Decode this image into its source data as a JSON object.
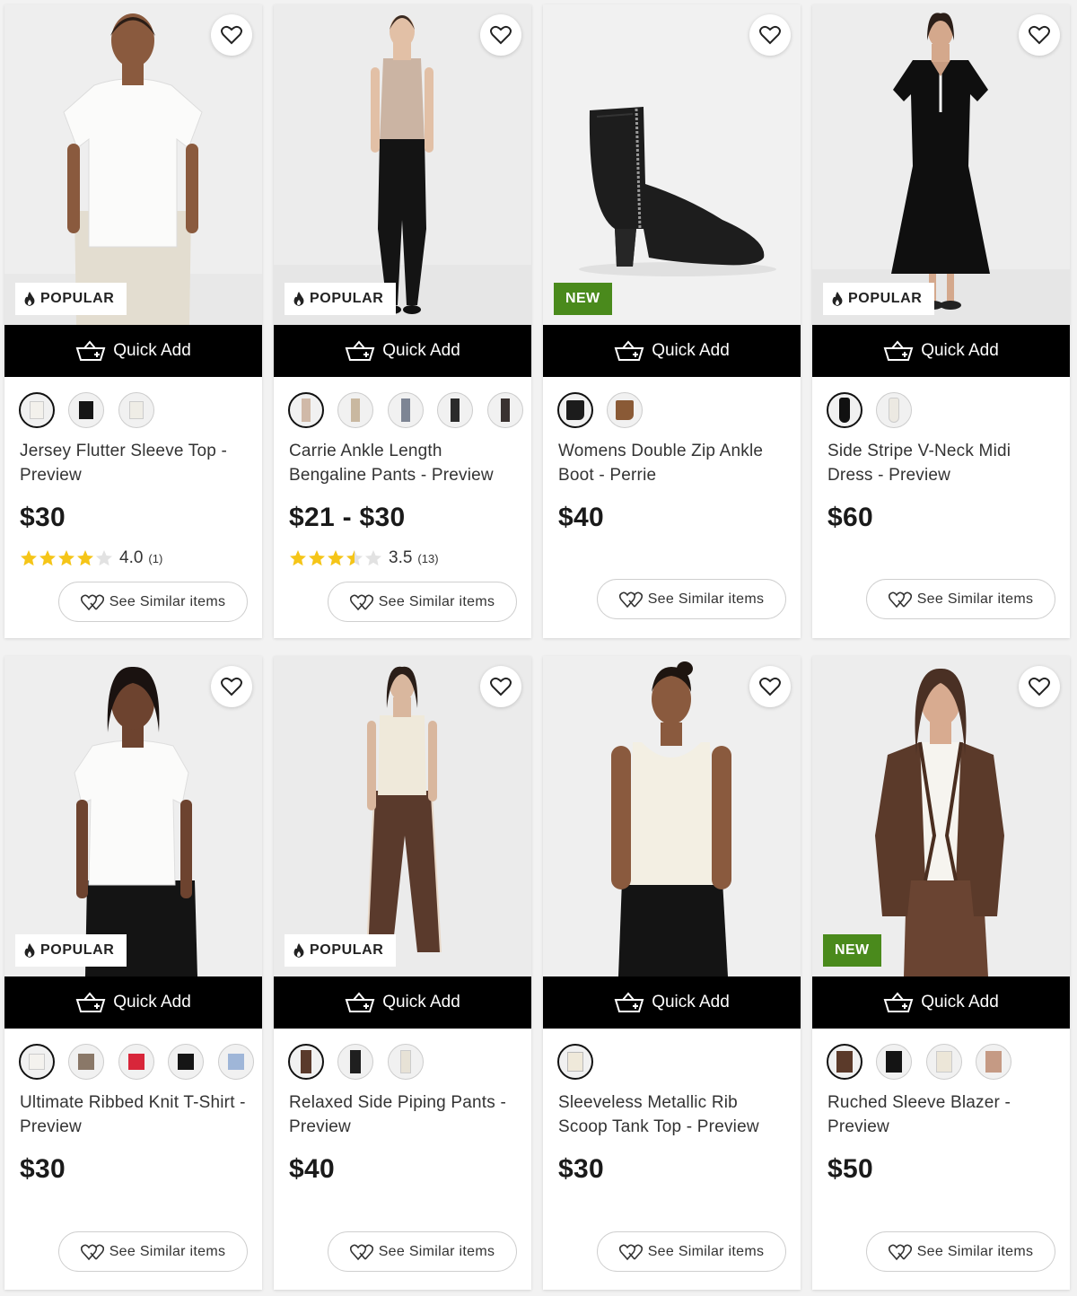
{
  "colors": {
    "badge_new": "#4a8a1c",
    "quick_add_bg": "#000000",
    "star": "#f5c518"
  },
  "products": [
    {
      "name": "Jersey Flutter Sleeve Top - Preview",
      "price": "$30",
      "badge": "POPULAR",
      "quick_add": "Quick Add",
      "rating": {
        "value": "4.0",
        "count": "(1)",
        "stars": 4.0
      },
      "similar": "See Similar items",
      "swatch_colors": [
        "#f3f1ec",
        "#151515",
        "#efede6"
      ],
      "has_more_swatches": false
    },
    {
      "name": "Carrie Ankle Length Bengaline Pants - Preview",
      "price": "$21 - $30",
      "badge": "POPULAR",
      "quick_add": "Quick Add",
      "rating": {
        "value": "3.5",
        "count": "(13)",
        "stars": 3.5
      },
      "similar": "See Similar items",
      "swatch_colors": [
        "#d0b9a8",
        "#c9b8a0",
        "#7d8594",
        "#2b2b2b",
        "#3a3230"
      ],
      "has_more_swatches": true
    },
    {
      "name": "Womens Double Zip Ankle Boot - Perrie",
      "price": "$40",
      "badge": "NEW",
      "quick_add": "Quick Add",
      "rating": null,
      "similar": "See Similar items",
      "swatch_colors": [
        "#1c1c1c",
        "#8a5a36"
      ],
      "has_more_swatches": false
    },
    {
      "name": "Side Stripe V-Neck Midi Dress - Preview",
      "price": "$60",
      "badge": "POPULAR",
      "quick_add": "Quick Add",
      "rating": null,
      "similar": "See Similar items",
      "swatch_colors": [
        "#111111",
        "#ece9e2"
      ],
      "has_more_swatches": false
    },
    {
      "name": "Ultimate Ribbed Knit T-Shirt - Preview",
      "price": "$30",
      "badge": "POPULAR",
      "quick_add": "Quick Add",
      "rating": null,
      "similar": "See Similar items",
      "swatch_colors": [
        "#f4f2ee",
        "#8a7868",
        "#d8263a",
        "#151515",
        "#9fb6d8"
      ],
      "has_more_swatches": true
    },
    {
      "name": "Relaxed Side Piping Pants - Preview",
      "price": "$40",
      "badge": "POPULAR",
      "quick_add": "Quick Add",
      "rating": null,
      "similar": "See Similar items",
      "swatch_colors": [
        "#5a3a2c",
        "#1f1f1f",
        "#e7e2d6"
      ],
      "has_more_swatches": false
    },
    {
      "name": "Sleeveless Metallic Rib Scoop Tank Top - Preview",
      "price": "$30",
      "badge": "",
      "quick_add": "Quick Add",
      "rating": null,
      "similar": "See Similar items",
      "swatch_colors": [
        "#efe9da"
      ],
      "has_more_swatches": false
    },
    {
      "name": "Ruched Sleeve Blazer - Preview",
      "price": "$50",
      "badge": "NEW",
      "quick_add": "Quick Add",
      "rating": null,
      "similar": "See Similar items",
      "swatch_colors": [
        "#5b3a2a",
        "#141414",
        "#ece6d8",
        "#c59a84"
      ],
      "has_more_swatches": false
    }
  ]
}
